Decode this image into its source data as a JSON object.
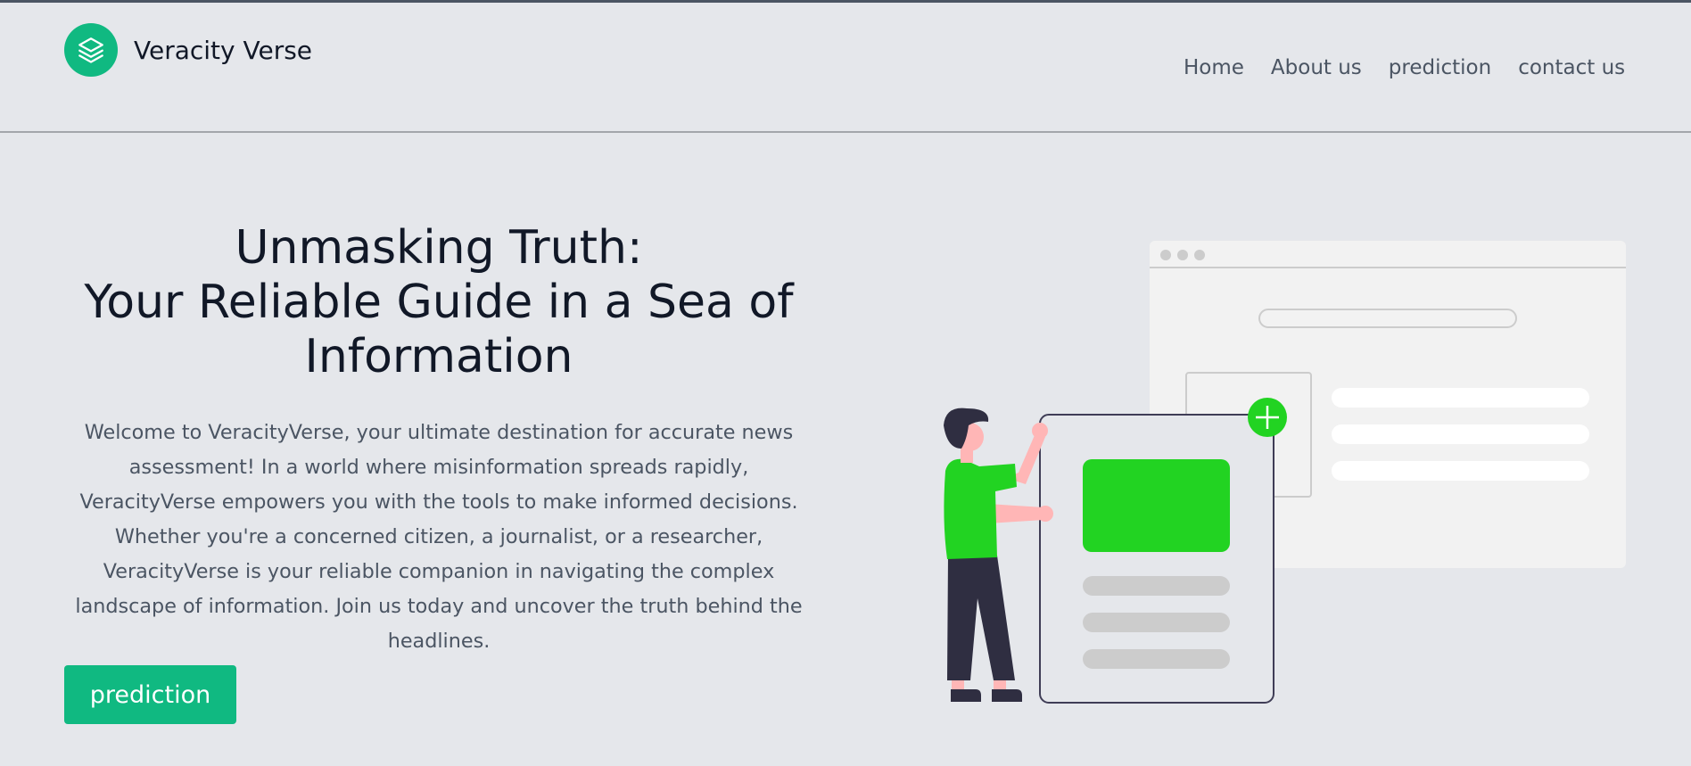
{
  "brand": {
    "name": "Veracity Verse",
    "accent": "#10b981"
  },
  "nav": {
    "items": [
      "Home",
      "About us",
      "prediction",
      "contact us"
    ]
  },
  "hero": {
    "title_lines": [
      "Unmasking Truth:",
      "Your Reliable Guide in a Sea of",
      "Information"
    ],
    "description": "Welcome to VeracityVerse, your ultimate destination for accurate news assessment! In a world where misinformation spreads rapidly, VeracityVerse empowers you with the tools to make informed decisions. Whether you're a concerned citizen, a journalist, or a researcher, VeracityVerse is your reliable companion in navigating the complex landscape of information. Join us today and uncover the truth behind the headlines.",
    "cta_label": "prediction"
  },
  "illustration": {
    "accent_green": "#22d322",
    "skin": "#ffb6b6",
    "dark": "#2f2e41"
  }
}
